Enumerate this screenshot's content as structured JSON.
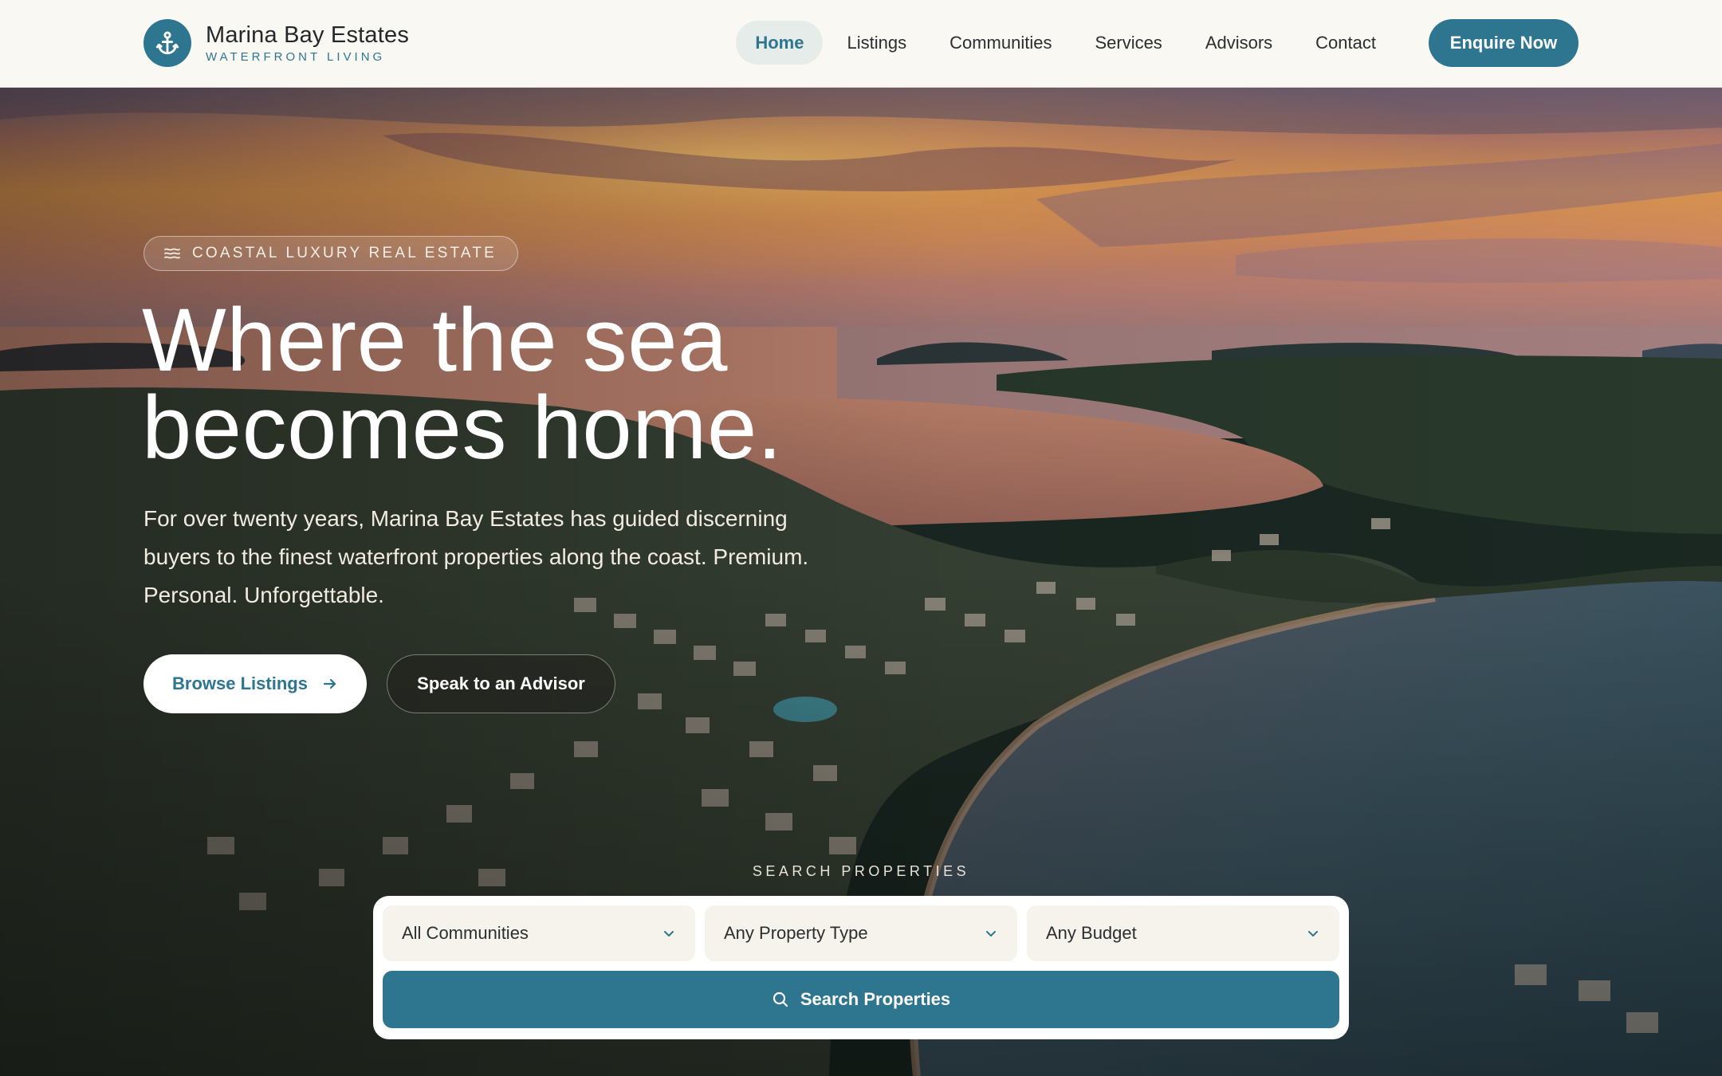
{
  "brand": {
    "name": "Marina Bay Estates",
    "tagline": "WATERFRONT LIVING",
    "logo_icon": "anchor-icon"
  },
  "nav": {
    "items": [
      {
        "label": "Home",
        "active": true
      },
      {
        "label": "Listings",
        "active": false
      },
      {
        "label": "Communities",
        "active": false
      },
      {
        "label": "Services",
        "active": false
      },
      {
        "label": "Advisors",
        "active": false
      },
      {
        "label": "Contact",
        "active": false
      }
    ],
    "cta_label": "Enquire Now"
  },
  "hero": {
    "eyebrow": "COASTAL LUXURY REAL ESTATE",
    "eyebrow_icon": "waves-icon",
    "headline_line1": "Where the sea",
    "headline_line2": "becomes home.",
    "lede": "For over twenty years, Marina Bay Estates has guided discerning buyers to the finest waterfront properties along the coast. Premium. Personal. Unforgettable.",
    "primary_button": "Browse Listings",
    "primary_button_icon": "arrow-right-icon",
    "secondary_button": "Speak to an Advisor"
  },
  "search": {
    "label": "SEARCH PROPERTIES",
    "community": {
      "selected": "All Communities"
    },
    "property_type": {
      "selected": "Any Property Type"
    },
    "budget": {
      "selected": "Any Budget"
    },
    "button_label": "Search Properties",
    "button_icon": "search-icon"
  },
  "colors": {
    "accent": "#2e7590",
    "header_bg": "#faf8f3",
    "sky_warm": "#e99a4c",
    "sea": "#3d5b66",
    "forest": "#2a3a28"
  }
}
